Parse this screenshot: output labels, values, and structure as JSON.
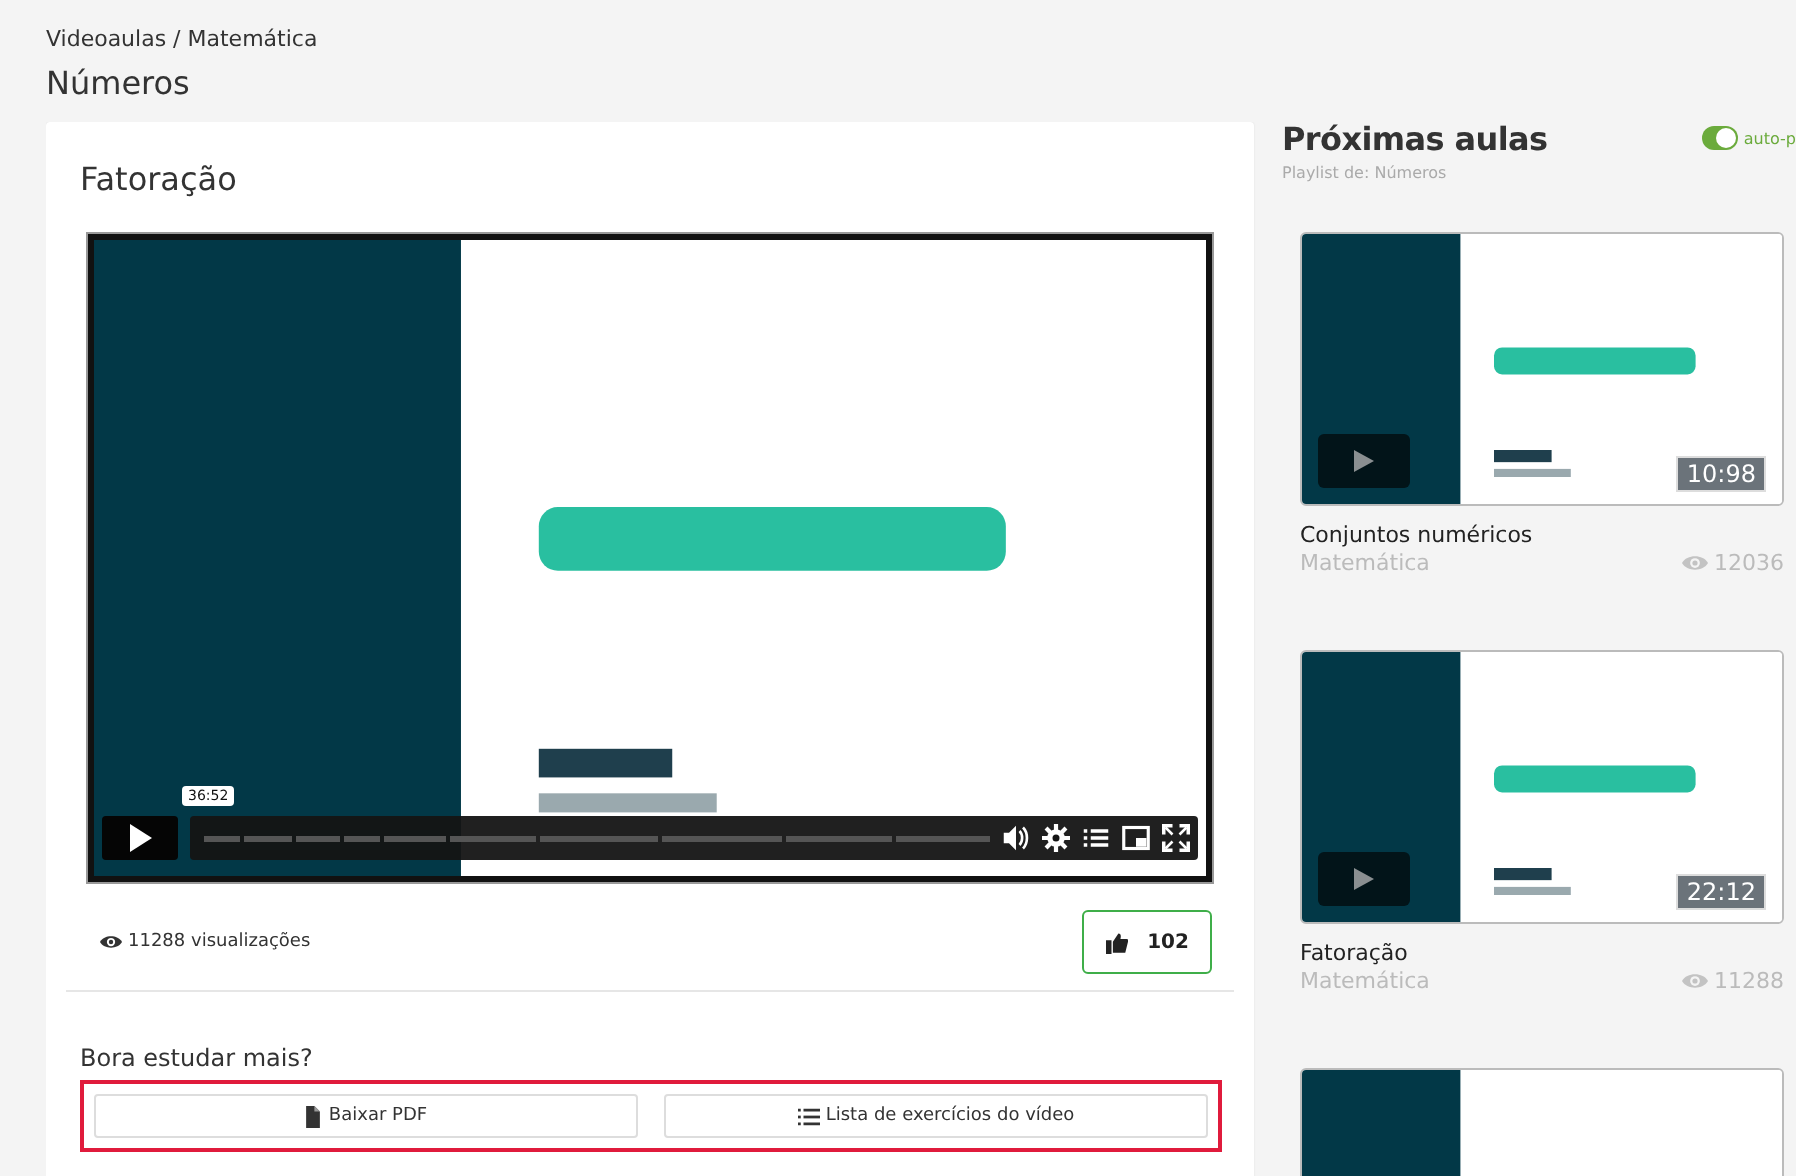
{
  "breadcrumb": "Videoaulas / Matemática",
  "page_title": "Números",
  "lesson": {
    "title": "Fatoração",
    "player": {
      "kind": "picture",
      "playing": false,
      "time_tooltip": "36:52"
    },
    "views": "11288 visualizações",
    "likes": "102",
    "prompt": "Bora estudar mais?",
    "highlighted": true,
    "actions": [
      {
        "label": "Baixar PDF",
        "kind": "download"
      },
      {
        "label": "Lista de exercícios do vídeo",
        "kind": "list"
      }
    ]
  },
  "playlist": {
    "title": "Próximas aulas",
    "subtitle": "Playlist de: Números",
    "autoplay": {
      "label": "auto-p",
      "on": true
    },
    "items": [
      {
        "kind": "picture",
        "duration": "10:98",
        "title": "Conjuntos numéricos",
        "subject": "Matemática",
        "views": "12036"
      },
      {
        "kind": "picture",
        "duration": "22:12",
        "title": "Fatoração",
        "subject": "Matemática",
        "views": "11288"
      },
      {
        "kind": "picture"
      }
    ]
  }
}
